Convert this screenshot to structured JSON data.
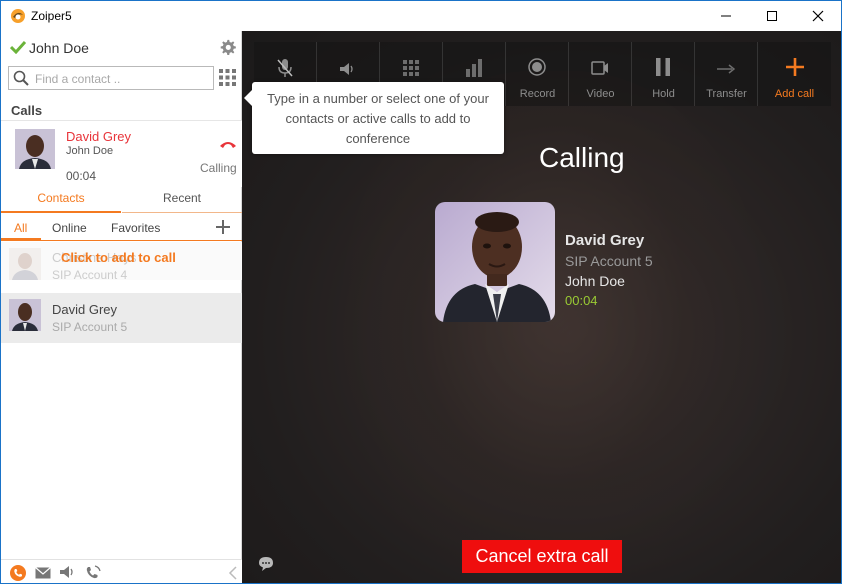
{
  "window": {
    "title": "Zoiper5"
  },
  "account": {
    "name": "John Doe",
    "status_color": "#6bb33a"
  },
  "search": {
    "placeholder": "Find a contact .."
  },
  "calls": {
    "header": "Calls",
    "item": {
      "name": "David Grey",
      "account": "John Doe",
      "timer": "00:04",
      "status": "Calling"
    }
  },
  "tabs": {
    "contacts": "Contacts",
    "recent": "Recent"
  },
  "subtabs": {
    "all": "All",
    "online": "Online",
    "favorites": "Favorites"
  },
  "contacts": [
    {
      "name": "Christine Hays",
      "sub": "SIP Account 4",
      "hint": "Click to add to call"
    },
    {
      "name": "David Grey",
      "sub": "SIP Account 5"
    }
  ],
  "toolbar": {
    "record": "Record",
    "video": "Video",
    "hold": "Hold",
    "transfer": "Transfer",
    "add_call": "Add call"
  },
  "tooltip": {
    "text": "Type in a number or select one of your contacts or active calls to add to conference"
  },
  "active_call": {
    "state": "Calling",
    "peer_name": "David Grey",
    "peer_account": "SIP Account 5",
    "own_name": "John Doe",
    "timer": "00:04"
  },
  "cancel_button": {
    "label": "Cancel extra call"
  },
  "colors": {
    "accent": "#f47a20",
    "danger": "#ef0e0e",
    "timer": "#9acb34"
  }
}
